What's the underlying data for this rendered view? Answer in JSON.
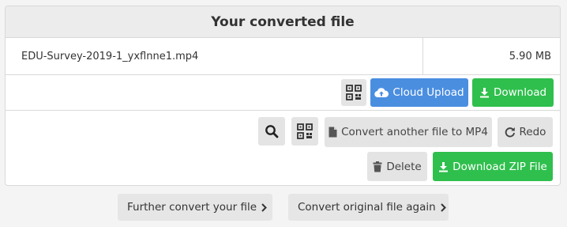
{
  "header": {
    "title": "Your converted file"
  },
  "file": {
    "name": "EDU-Survey-2019-1_yxflnne1.mp4",
    "size": "5.90 MB"
  },
  "actions_primary": {
    "cloud_upload_label": "Cloud Upload",
    "download_label": "Download"
  },
  "actions_secondary": {
    "convert_another_label": "Convert another file to MP4",
    "redo_label": "Redo",
    "delete_label": "Delete",
    "download_zip_label": "Download ZIP File"
  },
  "footer": {
    "further_convert_label": "Further convert your file",
    "convert_again_label": "Convert original file again"
  },
  "colors": {
    "blue": "#4a8ee0",
    "green": "#2fbf4d",
    "gray_button": "#e4e4e4"
  },
  "icons": {
    "qr": "qr-code-icon",
    "cloud": "cloud-upload-icon",
    "download": "download-icon",
    "search": "search-icon",
    "file": "file-icon",
    "redo": "redo-icon",
    "trash": "trash-icon",
    "chevron": "chevron-right-icon"
  }
}
